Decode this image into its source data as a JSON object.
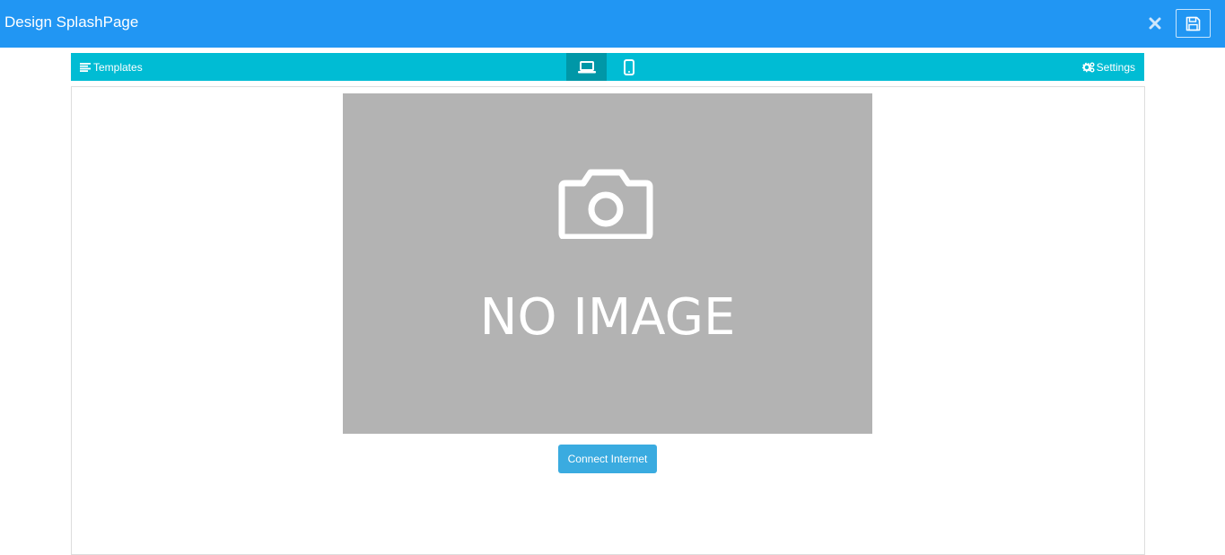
{
  "header": {
    "title": "Design SplashPage",
    "close_icon": "close-icon",
    "save_icon": "floppy-disk-icon",
    "background_color": "#2196f3"
  },
  "toolbar": {
    "templates_label": "Templates",
    "templates_icon": "list-icon",
    "desktop_icon": "laptop-icon",
    "mobile_icon": "mobile-phone-icon",
    "active_device": "desktop",
    "settings_label": "Settings",
    "settings_icon": "gears-icon",
    "background_color": "#00bcd4"
  },
  "canvas": {
    "image_placeholder_text": "NO IMAGE",
    "image_placeholder_icon": "camera-icon",
    "connect_button_label": "Connect Internet",
    "connect_button_color": "#3aabe0"
  }
}
